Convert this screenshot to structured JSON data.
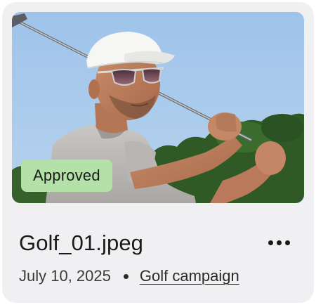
{
  "asset_card": {
    "image_alt": "Golfer in white cap and sunglasses mid-swing",
    "status_badge": "Approved",
    "file_name": "Golf_01.jpeg",
    "date": "July 10, 2025",
    "campaign_link": "Golf campaign",
    "more_icon": "more-horizontal-icon"
  },
  "colors": {
    "card_background": "#f0eff1",
    "badge_background": "#b3e1a8",
    "text_primary": "#1a1a1a",
    "sky": "#9fc4ea",
    "foliage": "#2f5a26"
  }
}
